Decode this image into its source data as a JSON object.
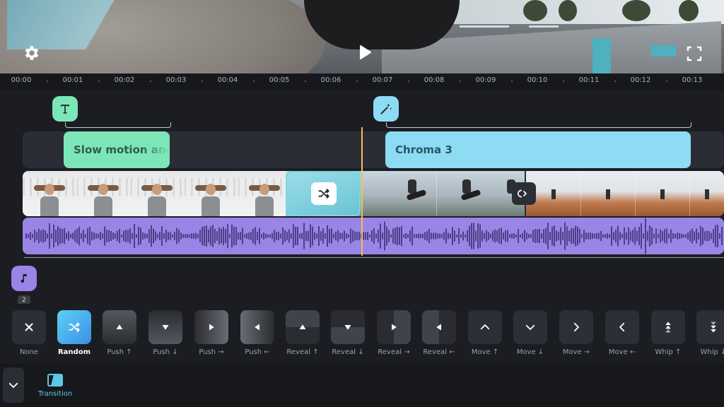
{
  "preview": {
    "icons": {
      "settings": "gear-icon",
      "play": "play-icon",
      "fullscreen": "fullscreen-icon"
    }
  },
  "ruler": {
    "ticks": [
      "00:00",
      "00:01",
      "00:02",
      "00:03",
      "00:04",
      "00:05",
      "00:06",
      "00:07",
      "00:08",
      "00:09",
      "00:10",
      "00:11",
      "00:12",
      "00:13"
    ]
  },
  "timeline": {
    "text_clip": {
      "label": "Slow motion and",
      "color": "#7de6b8"
    },
    "effect_clip": {
      "label": "Chroma 3",
      "color": "#8ddcf4"
    },
    "audio_color": "#9a84e6",
    "playhead_color": "#f2c14e",
    "music_badge": "2"
  },
  "transitions": {
    "items": [
      {
        "label": "None",
        "kind": "none"
      },
      {
        "label": "Random",
        "kind": "random"
      },
      {
        "label": "Push ↑",
        "kind": "push-up"
      },
      {
        "label": "Push ↓",
        "kind": "push-down"
      },
      {
        "label": "Push →",
        "kind": "push-right"
      },
      {
        "label": "Push ←",
        "kind": "push-left"
      },
      {
        "label": "Reveal ↑",
        "kind": "reveal-up"
      },
      {
        "label": "Reveal ↓",
        "kind": "reveal-down"
      },
      {
        "label": "Reveal →",
        "kind": "reveal-right"
      },
      {
        "label": "Reveal ←",
        "kind": "reveal-left"
      },
      {
        "label": "Move ↑",
        "kind": "move-up"
      },
      {
        "label": "Move ↓",
        "kind": "move-down"
      },
      {
        "label": "Move →",
        "kind": "move-right"
      },
      {
        "label": "Move ←",
        "kind": "move-left"
      },
      {
        "label": "Whip ↑",
        "kind": "whip-up"
      },
      {
        "label": "Whip ↓",
        "kind": "whip-down"
      }
    ],
    "selected": "Random",
    "accent": "#5fd1f2"
  },
  "bottombar": {
    "tool_label": "Transition",
    "tool_color": "#5cc7ea"
  }
}
